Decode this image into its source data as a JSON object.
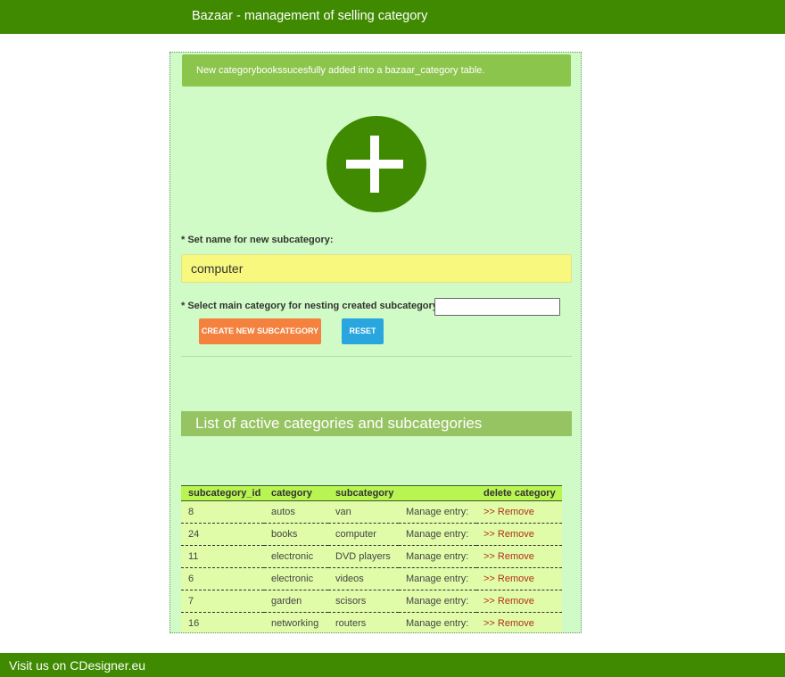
{
  "header": {
    "title": "Bazaar - management of selling category"
  },
  "alert": {
    "message": "New categorybookssucesfully added into a bazaar_category table."
  },
  "add_icon": {
    "icon": "plus-circle-icon",
    "color": "#3f8a00"
  },
  "form": {
    "name_label": "* Set name for new subcategory:",
    "name_value": "computer",
    "main_category_label": "* Select main category for nesting created subcategory:",
    "main_category_value": "",
    "create_button": "CREATE NEW SUBCATEGORY",
    "reset_button": "RESET"
  },
  "list": {
    "heading": "List of active categories and subcategories",
    "columns": [
      "subcategory_id",
      "category",
      "subcategory",
      "",
      "delete category"
    ],
    "rows": [
      {
        "id": "8",
        "category": "autos",
        "subcategory": "van",
        "manage": "Manage entry:",
        "remove": ">> Remove"
      },
      {
        "id": "24",
        "category": "books",
        "subcategory": "computer",
        "manage": "Manage entry:",
        "remove": ">> Remove"
      },
      {
        "id": "11",
        "category": "electronic",
        "subcategory": "DVD players",
        "manage": "Manage entry:",
        "remove": ">> Remove"
      },
      {
        "id": "6",
        "category": "electronic",
        "subcategory": "videos",
        "manage": "Manage entry:",
        "remove": ">> Remove"
      },
      {
        "id": "7",
        "category": "garden",
        "subcategory": "scisors",
        "manage": "Manage entry:",
        "remove": ">> Remove"
      },
      {
        "id": "16",
        "category": "networking",
        "subcategory": "routers",
        "manage": "Manage entry:",
        "remove": ">> Remove"
      }
    ]
  },
  "footer": {
    "link": "Visit us on CDesigner.eu"
  },
  "colors": {
    "brand_green": "#3f8a00",
    "panel_bg": "#d0fbc6",
    "alert_bg": "#8cc54c",
    "create_button": "#f4813e",
    "reset_button": "#2aa6de",
    "remove_link": "#b03018"
  }
}
